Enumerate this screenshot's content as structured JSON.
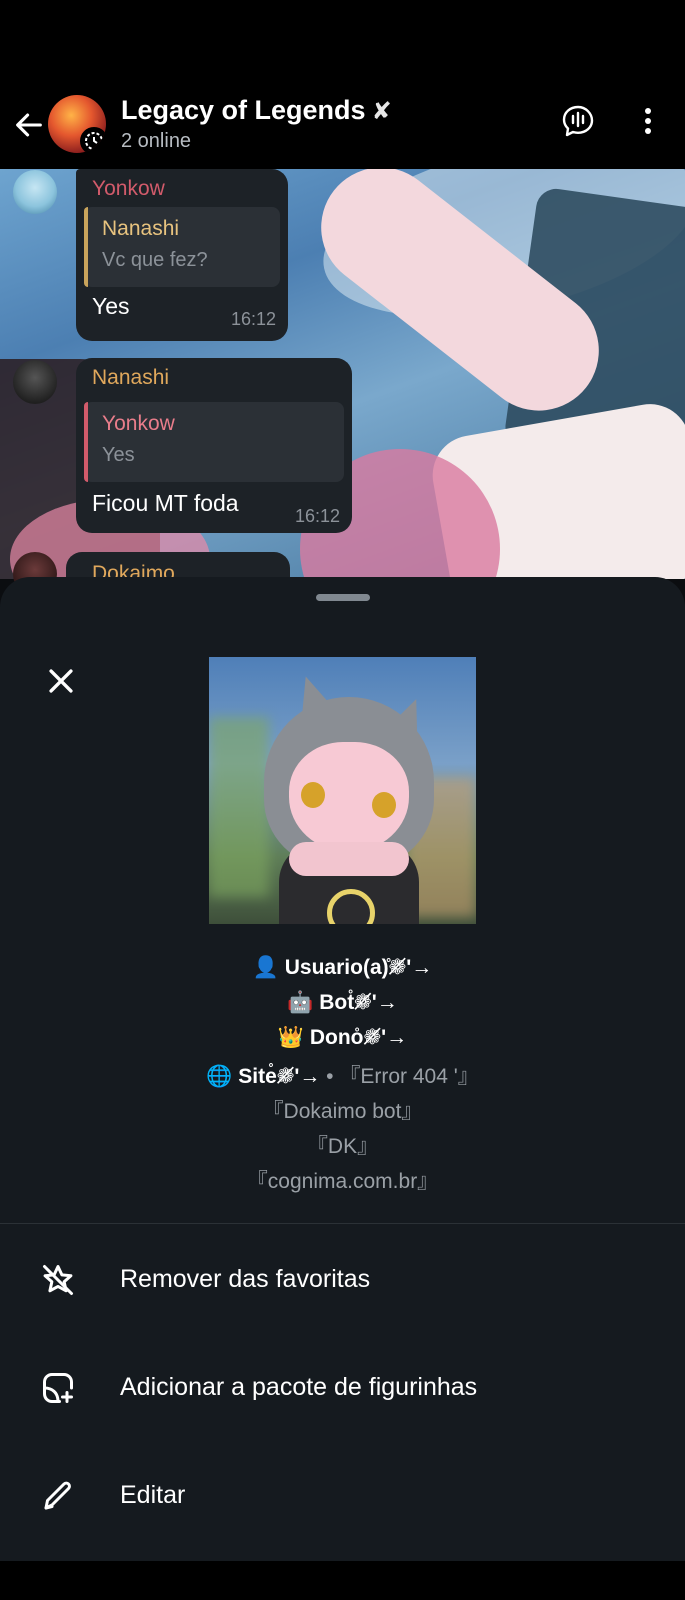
{
  "header": {
    "title": "Legacy of Legends",
    "title_suffix": "✘",
    "subtitle": "2 online"
  },
  "messages": [
    {
      "sender": "Yonkow",
      "sender_color": "#d25b6b",
      "reply_name": "Nanashi",
      "reply_text": "Vc que fez?",
      "reply_color": "#c9a45c",
      "text": "Yes",
      "time": "16:12"
    },
    {
      "sender": "Nanashi",
      "sender_color": "#e0a85c",
      "reply_name": "Yonkow",
      "reply_text": "Yes",
      "reply_color": "#d25b6b",
      "text": "Ficou MT foda",
      "time": "16:12"
    },
    {
      "sender": "Dokaimo",
      "sender_color": "#e0a85c"
    }
  ],
  "sticker_sheet": {
    "description_lines": [
      "👤 Usuario(a)̊❁̸'→",
      "🤖 Bot̊❁̸'→",
      "👑 Dono̊❁̸'→"
    ],
    "site_label": "🌐 Site̊❁̸'→",
    "site_meta": " • 『Error 404 '』",
    "info_lines": [
      "『Dokaimo bot』",
      "『DK』",
      "『cognima.com.br』"
    ],
    "menu": [
      {
        "label": "Remover das favoritas",
        "icon": "star-off-icon"
      },
      {
        "label": "Adicionar a pacote de figurinhas",
        "icon": "sticker-add-icon"
      },
      {
        "label": "Editar",
        "icon": "pencil-icon"
      }
    ]
  }
}
